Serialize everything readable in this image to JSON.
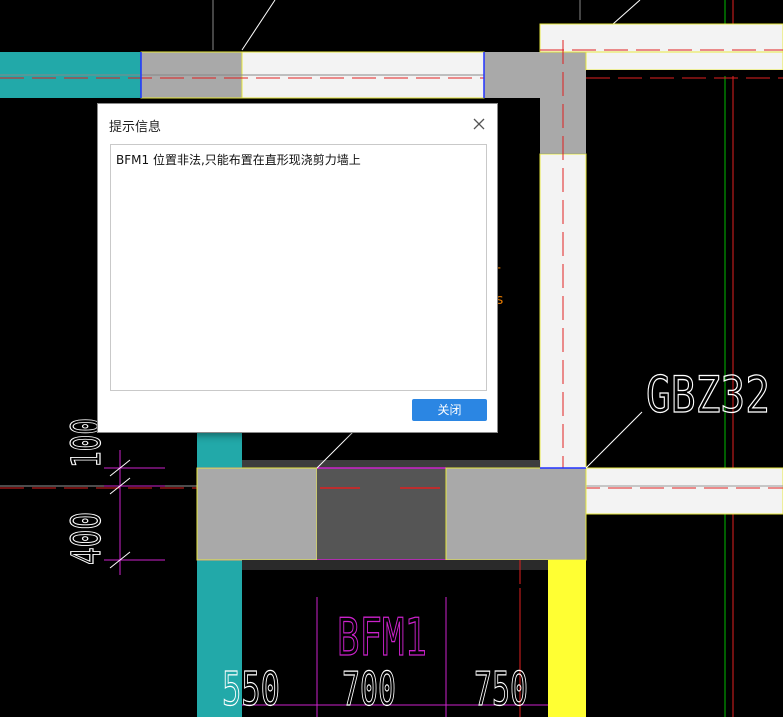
{
  "drawing": {
    "labels": {
      "gbz": "GBZ32",
      "bfm": "BFM1",
      "dim_100": "100",
      "dim_400": "400",
      "dim_550": "550",
      "dim_700": "700",
      "dim_750": "750"
    },
    "colors": {
      "background": "#000000",
      "wall_teal": "#22a9a9",
      "wall_white": "#f3f3f3",
      "column_gray": "#a9a9a9",
      "opening_dark": "#555555",
      "yellow_column": "#ffff33",
      "axis_red": "#e02020",
      "dimension_magenta": "#cc22cc",
      "annotation_white": "#ffffff",
      "outline_yellow": "#e8e840",
      "edge_blue": "#2233ff",
      "axis_green": "#00cc00",
      "orange": "#ff8800"
    }
  },
  "dialog": {
    "title": "提示信息",
    "message": "BFM1 位置非法,只能布置在直形现浇剪力墙上",
    "close_button": "关闭",
    "close_icon": "close-icon",
    "accent": "#2b86e3"
  }
}
